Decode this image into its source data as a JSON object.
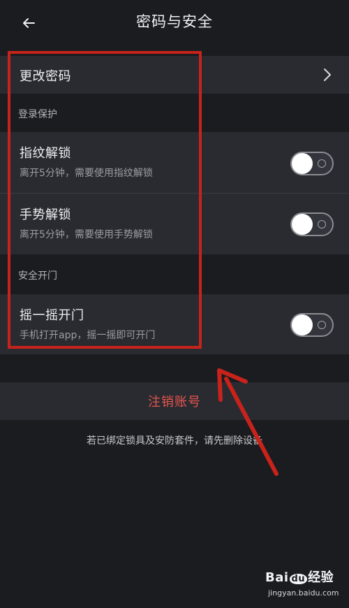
{
  "header": {
    "title": "密码与安全",
    "back_icon": "arrow-left-icon"
  },
  "change_password": {
    "label": "更改密码",
    "chevron_icon": "chevron-right-icon"
  },
  "sections": {
    "login_protection": "登录保护",
    "safe_door": "安全开门"
  },
  "fingerprint": {
    "title": "指纹解锁",
    "subtitle": "离开5分钟，需要使用指纹解锁",
    "enabled": false
  },
  "gesture": {
    "title": "手势解锁",
    "subtitle": "离开5分钟，需要使用手势解锁",
    "enabled": false
  },
  "shake": {
    "title": "摇一摇开门",
    "subtitle": "手机打开app，摇一摇即可开门",
    "enabled": false
  },
  "logout": {
    "label": "注销账号",
    "color": "#e8544e"
  },
  "note": "若已绑定锁具及安防套件，请先删除设备",
  "annotation": {
    "box_color": "#c7231b"
  },
  "watermark": {
    "brand_left": "Bai",
    "brand_mid": "du",
    "brand_right": "经验",
    "url": "jingyan.baidu.com"
  }
}
